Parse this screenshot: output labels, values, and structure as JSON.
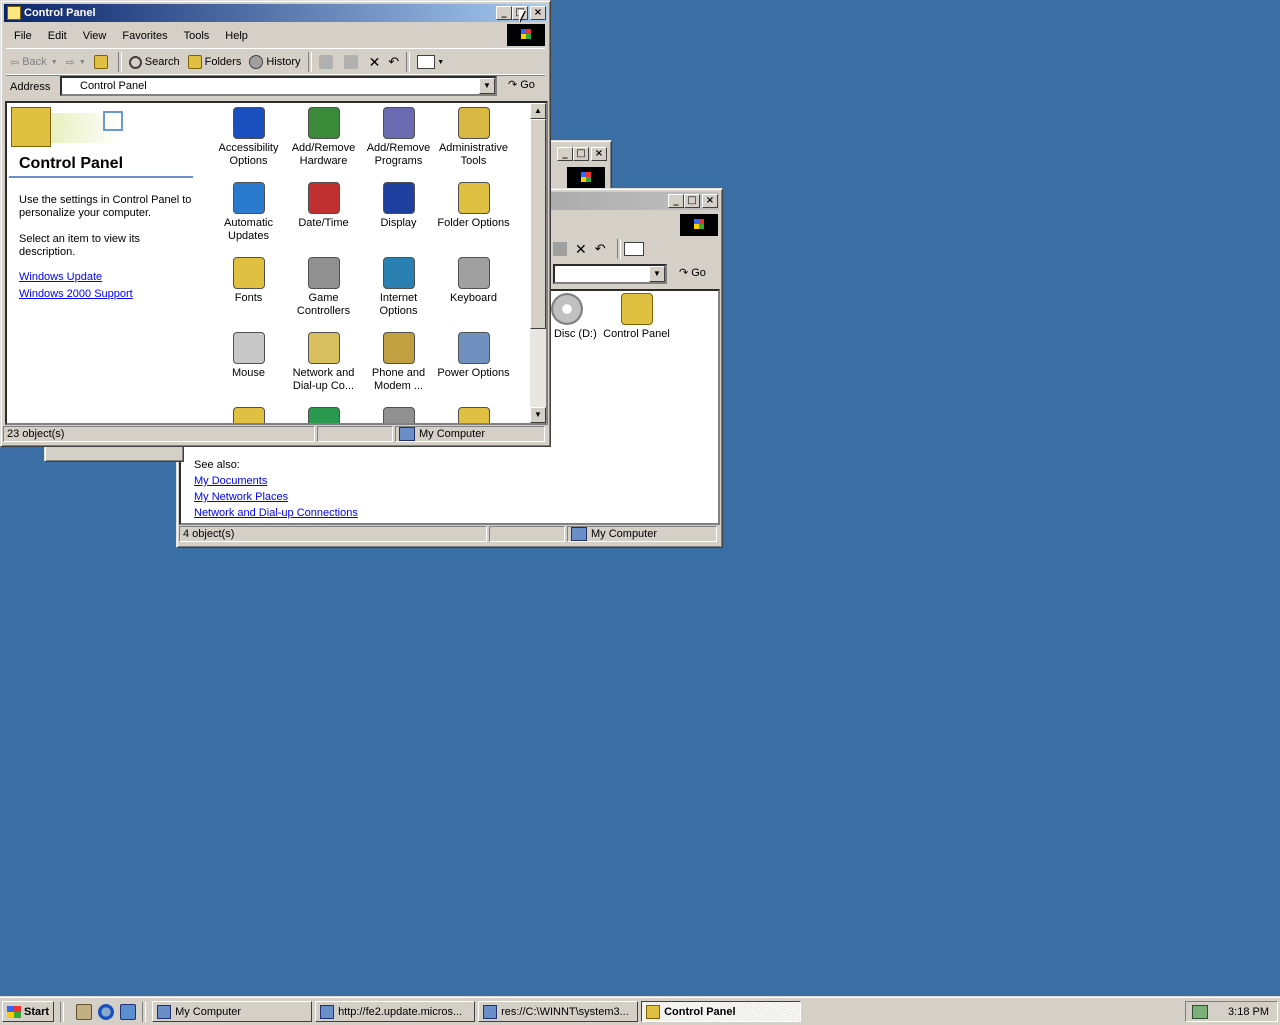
{
  "colors": {
    "desktop": "#3a6ea5",
    "title_active": "#0a246a",
    "link": "#0000ff"
  },
  "main_window": {
    "title": "Control Panel",
    "menu": [
      "File",
      "Edit",
      "View",
      "Favorites",
      "Tools",
      "Help"
    ],
    "toolbar": {
      "back": "Back",
      "search": "Search",
      "folders": "Folders",
      "history": "History"
    },
    "address_label": "Address",
    "address_value": "Control Panel",
    "go_label": "Go",
    "panel_title": "Control Panel",
    "description": "Use the settings in Control Panel to personalize your computer.",
    "select_hint": "Select an item to view its description.",
    "links": [
      "Windows Update",
      "Windows 2000 Support"
    ],
    "items": [
      {
        "label": "Accessibility Options",
        "icon": "accessibility-icon",
        "color": "#1a4fbf"
      },
      {
        "label": "Add/Remove Hardware",
        "icon": "add-hardware-icon",
        "color": "#3a8a3a"
      },
      {
        "label": "Add/Remove Programs",
        "icon": "add-programs-icon",
        "color": "#6a6ab0"
      },
      {
        "label": "Administrative Tools",
        "icon": "admin-tools-icon",
        "color": "#d8b840"
      },
      {
        "label": "Automatic Updates",
        "icon": "automatic-updates-icon",
        "color": "#2a7ad0"
      },
      {
        "label": "Date/Time",
        "icon": "date-time-icon",
        "color": "#c03030"
      },
      {
        "label": "Display",
        "icon": "display-icon",
        "color": "#2040a0"
      },
      {
        "label": "Folder Options",
        "icon": "folder-options-icon",
        "color": "#e0c040"
      },
      {
        "label": "Fonts",
        "icon": "fonts-icon",
        "color": "#e0c040"
      },
      {
        "label": "Game Controllers",
        "icon": "game-controllers-icon",
        "color": "#909090"
      },
      {
        "label": "Internet Options",
        "icon": "internet-options-icon",
        "color": "#2a80b0"
      },
      {
        "label": "Keyboard",
        "icon": "keyboard-icon",
        "color": "#a0a0a0"
      },
      {
        "label": "Mouse",
        "icon": "mouse-icon",
        "color": "#c8c8c8"
      },
      {
        "label": "Network and Dial-up Co...",
        "icon": "network-icon",
        "color": "#d8c060"
      },
      {
        "label": "Phone and Modem ...",
        "icon": "phone-modem-icon",
        "color": "#c0a040"
      },
      {
        "label": "Power Options",
        "icon": "power-options-icon",
        "color": "#7090c0"
      },
      {
        "label": "",
        "icon": "folder-icon",
        "color": "#e0c040"
      },
      {
        "label": "",
        "icon": "globe-icon",
        "color": "#2a9a50"
      },
      {
        "label": "",
        "icon": "scanner-icon",
        "color": "#909090"
      },
      {
        "label": "",
        "icon": "folder-icon",
        "color": "#e0c040"
      }
    ],
    "status_objects": "23 object(s)",
    "status_zone": "My Computer"
  },
  "back_window": {
    "items": [
      {
        "label": "act Disc (D:)",
        "icon": "compact-disc-icon",
        "color": "#c0c0c0"
      },
      {
        "label": "Control Panel",
        "icon": "control-panel-icon",
        "color": "#e0c040"
      }
    ],
    "go_label": "Go",
    "see_also_label": "See also:",
    "see_also_links": [
      "My Documents",
      "My Network Places",
      "Network and Dial-up Connections"
    ],
    "status_objects": "4 object(s)",
    "status_zone": "My Computer"
  },
  "taskbar": {
    "start_label": "Start",
    "buttons": [
      {
        "label": "My Computer",
        "active": false
      },
      {
        "label": "http://fe2.update.micros...",
        "active": false
      },
      {
        "label": "res://C:\\WINNT\\system3...",
        "active": false
      },
      {
        "label": "Control Panel",
        "active": true
      }
    ],
    "clock": "3:18 PM"
  }
}
